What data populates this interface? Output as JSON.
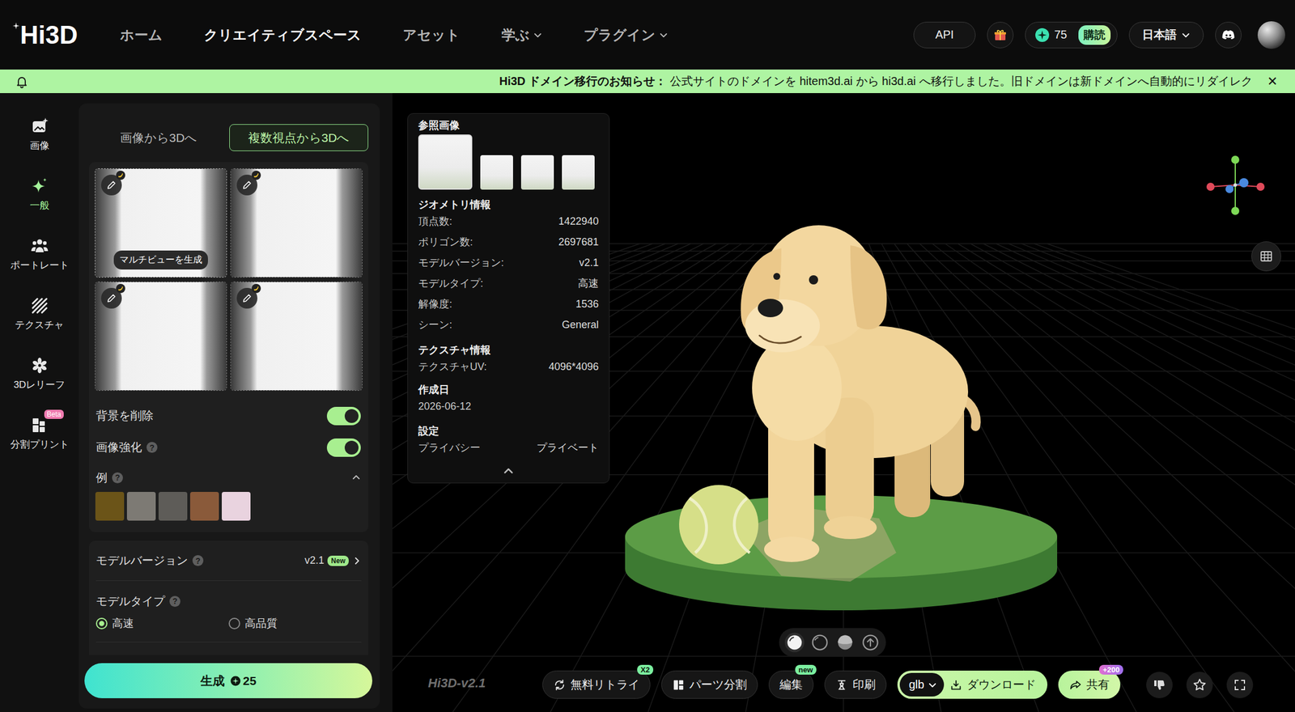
{
  "logo": {
    "text": "Hi3D"
  },
  "nav": [
    {
      "label": "ホーム",
      "selected": false,
      "dropdown": false
    },
    {
      "label": "クリエイティブスペース",
      "selected": true,
      "dropdown": false
    },
    {
      "label": "アセット",
      "selected": false,
      "dropdown": false
    },
    {
      "label": "学ぶ",
      "selected": false,
      "dropdown": true
    },
    {
      "label": "プラグイン",
      "selected": false,
      "dropdown": true
    }
  ],
  "header": {
    "api": "API",
    "credits": "75",
    "subscribe": "購読",
    "language": "日本語"
  },
  "notice": {
    "title": "Hi3D ドメイン移行のお知らせ：",
    "text": "公式サイトのドメインを hitem3d.ai から hi3d.ai へ移行しました。旧ドメインは新ドメインへ自動的にリダイレク",
    "close": "✕"
  },
  "sidebar": {
    "items": [
      {
        "label": "画像",
        "selected": false
      },
      {
        "label": "一般",
        "selected": true
      },
      {
        "label": "ポートレート",
        "selected": false
      },
      {
        "label": "テクスチャ",
        "selected": false
      },
      {
        "label": "3Dレリーフ",
        "selected": false
      },
      {
        "label": "分割プリント",
        "selected": false,
        "badge": "Beta"
      }
    ]
  },
  "panel": {
    "tabs": [
      {
        "label": "画像から3Dへ",
        "selected": false
      },
      {
        "label": "複数視点から3Dへ",
        "selected": true
      }
    ],
    "views": [
      {
        "hovered": true,
        "tooltip": "マルチビューを生成"
      },
      {
        "hovered": false
      },
      {
        "hovered": false
      },
      {
        "hovered": false
      }
    ],
    "toggles": [
      {
        "label": "背景を削除",
        "on": true
      },
      {
        "label": "画像強化",
        "on": true,
        "help": "?"
      }
    ],
    "examples": {
      "label": "例",
      "help": "?",
      "expanded": true,
      "items": [
        {
          "color": "#6b5418"
        },
        {
          "color": "#7d7a74"
        },
        {
          "color": "#5e5c58"
        },
        {
          "color": "#8a5a3a"
        },
        {
          "color": "#e9d3df"
        }
      ]
    },
    "model_version": {
      "label": "モデルバージョン",
      "help": "?",
      "value": "v2.1",
      "badge": "New"
    },
    "model_type": {
      "label": "モデルタイプ",
      "help": "?",
      "options": [
        {
          "label": "高速",
          "selected": true
        },
        {
          "label": "高品質",
          "selected": false
        }
      ]
    },
    "generate": {
      "label": "生成",
      "cost": "25"
    }
  },
  "viewer": {
    "info": {
      "reference_title": "参照画像",
      "references": [
        {
          "selected": true
        },
        {
          "selected": false
        },
        {
          "selected": false
        },
        {
          "selected": false
        }
      ],
      "geometry_title": "ジオメトリ情報",
      "geometry": [
        {
          "label": "頂点数:",
          "value": "1422940"
        },
        {
          "label": "ポリゴン数:",
          "value": "2697681"
        },
        {
          "label": "モデルバージョン:",
          "value": "v2.1"
        },
        {
          "label": "モデルタイプ:",
          "value": "高速"
        },
        {
          "label": "解像度:",
          "value": "1536"
        },
        {
          "label": "シーン:",
          "value": "General"
        }
      ],
      "texture_title": "テクスチャ情報",
      "texture": [
        {
          "label": "テクスチャUV:",
          "value": "4096*4096"
        }
      ],
      "created_title": "作成日",
      "created": "2026-06-12",
      "settings_title": "設定",
      "settings": [
        {
          "label": "プライバシー",
          "value": "プライベート"
        }
      ],
      "expanded": true
    },
    "render_modes": [
      {
        "selected": true
      },
      {
        "selected": false
      },
      {
        "selected": false
      },
      {
        "selected": false
      }
    ],
    "watermark": "Hi3D-v2.1",
    "tools": [
      {
        "label": "無料リトライ",
        "badge": "X2"
      },
      {
        "label": "パーツ分割"
      },
      {
        "label": "編集",
        "badge": "new"
      },
      {
        "label": "印刷"
      }
    ],
    "format": "glb",
    "download": "ダウンロード",
    "share": {
      "label": "共有",
      "badge": "+200"
    }
  }
}
